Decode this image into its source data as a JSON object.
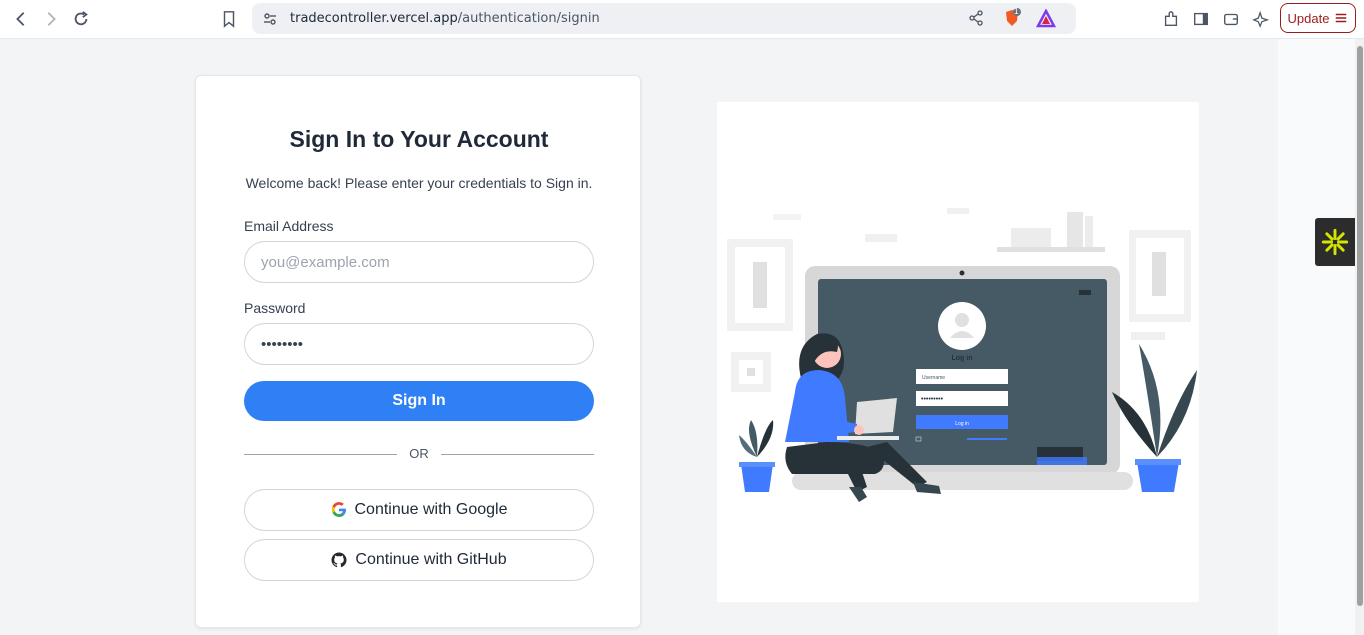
{
  "browser": {
    "url_host": "tradecontroller.vercel.app",
    "url_path": "/authentication/signin",
    "update_label": "Update",
    "shield_badge": "1"
  },
  "signin": {
    "title": "Sign In to Your Account",
    "subtitle": "Welcome back! Please enter your credentials to Sign in.",
    "email_label": "Email Address",
    "email_placeholder": "you@example.com",
    "password_label": "Password",
    "password_value": "password",
    "signin_label": "Sign In",
    "or_label": "OR",
    "google_label": "Continue with Google",
    "github_label": "Continue with GitHub"
  },
  "illustration": {
    "login_title": "Log in",
    "username_placeholder": "Username",
    "login_button": "Log in"
  },
  "colors": {
    "primary": "#2f7ff5",
    "update_red": "#9b1c1c"
  }
}
